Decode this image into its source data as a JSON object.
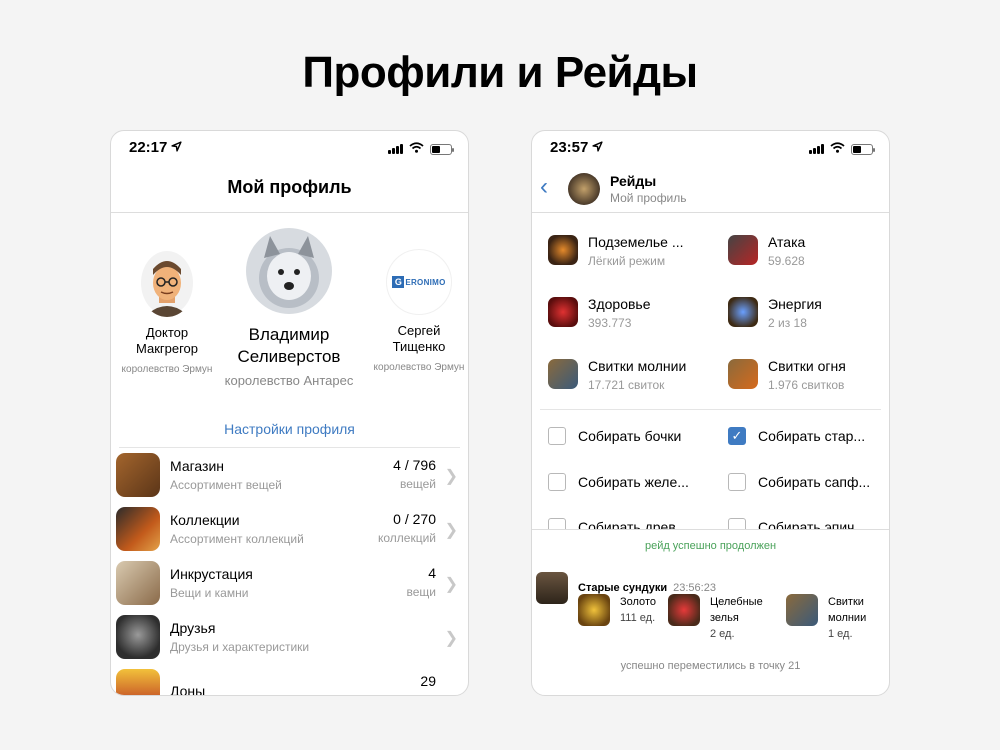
{
  "page_title": "Профили и Рейды",
  "left_phone": {
    "status_time": "22:17",
    "nav_title": "Мой профиль",
    "friends": [
      {
        "name": "Доктор Макгрегор",
        "kingdom": "королевство Эрмун"
      },
      {
        "name": "Владимир Селиверстов",
        "kingdom": "королевство Антарес"
      },
      {
        "name": "Сергей Тищенко",
        "kingdom": "королевство Эрмун"
      }
    ],
    "geronimo_logo": "GERONIMO",
    "settings_link": "Настройки профиля",
    "menu": [
      {
        "title": "Магазин",
        "subtitle": "Ассортимент вещей",
        "count": "4 / 796",
        "unit": "вещей"
      },
      {
        "title": "Коллекции",
        "subtitle": "Ассортимент коллекций",
        "count": "0 / 270",
        "unit": "коллекций"
      },
      {
        "title": "Инкрустация",
        "subtitle": "Вещи и камни",
        "count": "4",
        "unit": "вещи"
      },
      {
        "title": "Друзья",
        "subtitle": "Друзья и характеристики",
        "count": "",
        "unit": ""
      },
      {
        "title": "Доны",
        "subtitle": "",
        "count": "29",
        "unit": ""
      }
    ]
  },
  "right_phone": {
    "status_time": "23:57",
    "nav_title": "Рейды",
    "nav_subtitle": "Мой профиль",
    "stats": [
      {
        "title": "Подземелье ...",
        "value": "Лёгкий режим"
      },
      {
        "title": "Атака",
        "value": "59.628"
      },
      {
        "title": "Здоровье",
        "value": "393.773"
      },
      {
        "title": "Энергия",
        "value": "2 из 18"
      },
      {
        "title": "Свитки молнии",
        "value": "17.721 свиток"
      },
      {
        "title": "Свитки огня",
        "value": "1.976 свитков"
      }
    ],
    "checks": [
      {
        "label": "Собирать бочки",
        "checked": false
      },
      {
        "label": "Собирать стар...",
        "checked": true
      },
      {
        "label": "Собирать желе...",
        "checked": false
      },
      {
        "label": "Собирать сапф...",
        "checked": false
      },
      {
        "label": "Собирать древ...",
        "checked": false
      },
      {
        "label": "Собирать эпич...",
        "checked": false
      }
    ],
    "success_msg": "рейд успешно продолжен",
    "log_title": "Старые сундуки",
    "log_time": "23:56:23",
    "loot": [
      {
        "name": "Золото",
        "qty": "111 ед."
      },
      {
        "name": "Целебные зелья",
        "qty": "2 ед."
      },
      {
        "name": "Свитки молнии",
        "qty": "1 ед."
      }
    ],
    "moved_msg": "успешно переместились в точку 21"
  }
}
